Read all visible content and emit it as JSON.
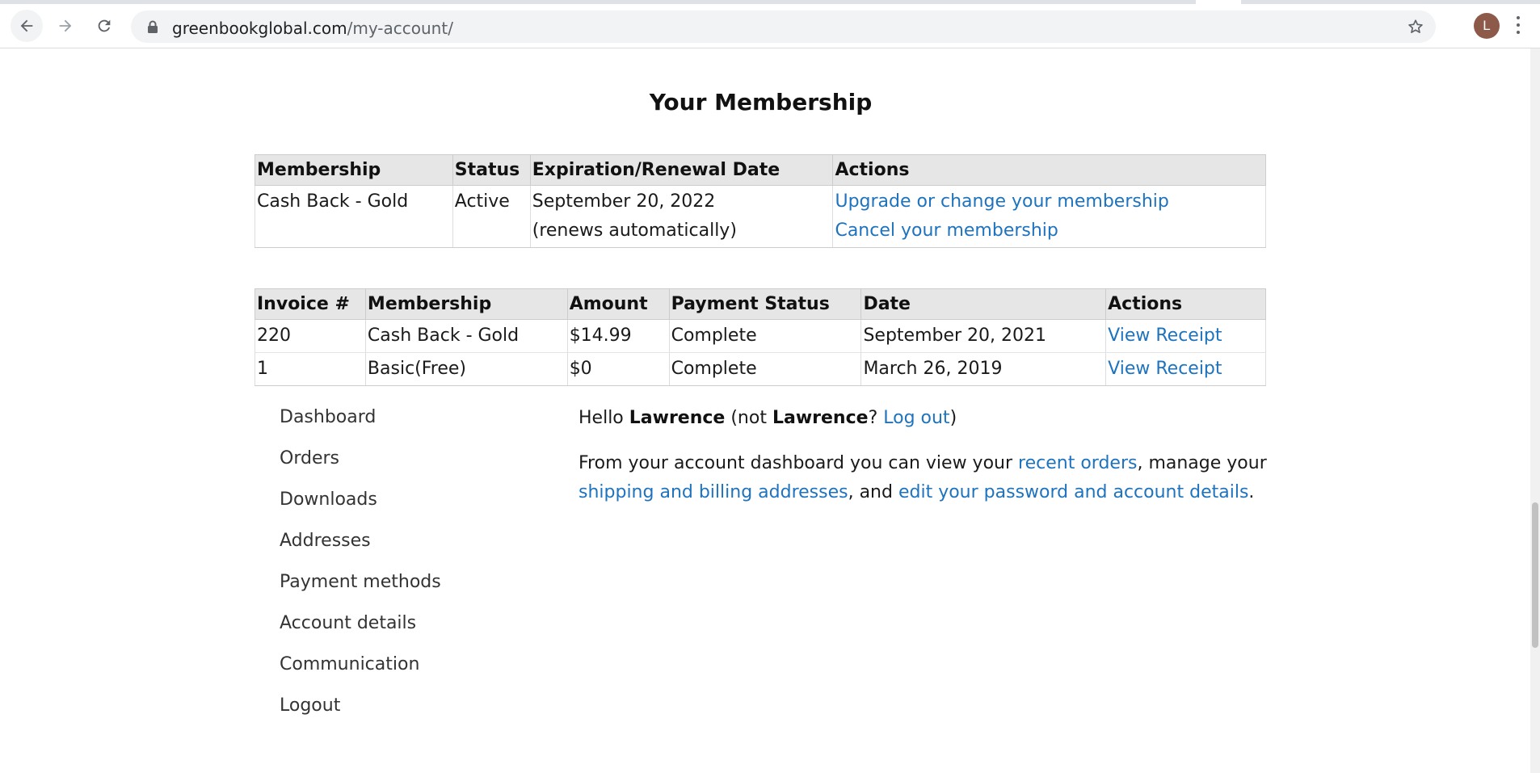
{
  "browser": {
    "url_host": "greenbookglobal.com",
    "url_path": "/my-account/",
    "avatar_initial": "L"
  },
  "page": {
    "title": "Your Membership"
  },
  "membership_table": {
    "headers": [
      "Membership",
      "Status",
      "Expiration/Renewal Date",
      "Actions"
    ],
    "row": {
      "membership": "Cash Back - Gold",
      "status": "Active",
      "date": "September 20, 2022",
      "renew_note": "(renews automatically)",
      "action_upgrade": "Upgrade or change your membership",
      "action_cancel": "Cancel your membership"
    }
  },
  "invoice_table": {
    "headers": [
      "Invoice #",
      "Membership",
      "Amount",
      "Payment Status",
      "Date",
      "Actions"
    ],
    "rows": [
      {
        "invoice": "220",
        "membership": "Cash Back - Gold",
        "amount": "$14.99",
        "status": "Complete",
        "date": "September 20, 2021",
        "action": "View Receipt"
      },
      {
        "invoice": "1",
        "membership": "Basic(Free)",
        "amount": "$0",
        "status": "Complete",
        "date": "March 26, 2019",
        "action": "View Receipt"
      }
    ]
  },
  "account_nav": {
    "items": [
      "Dashboard",
      "Orders",
      "Downloads",
      "Addresses",
      "Payment methods",
      "Account details",
      "Communication",
      "Logout"
    ]
  },
  "dashboard": {
    "hello_prefix": "Hello ",
    "user_name": "Lawrence",
    "not_prefix": " (not ",
    "not_name": "Lawrence",
    "question": "? ",
    "logout_link": "Log out",
    "close_paren": ")",
    "intro_1": "From your account dashboard you can view your ",
    "link_orders": "recent orders",
    "intro_2": ", manage your ",
    "link_addresses": "shipping and billing addresses",
    "intro_3": ", and ",
    "link_account": "edit your password and account details",
    "intro_4": "."
  },
  "colors": {
    "link": "#1e73be",
    "header_bg": "#e6e6e6",
    "avatar": "#8d5a4a"
  }
}
